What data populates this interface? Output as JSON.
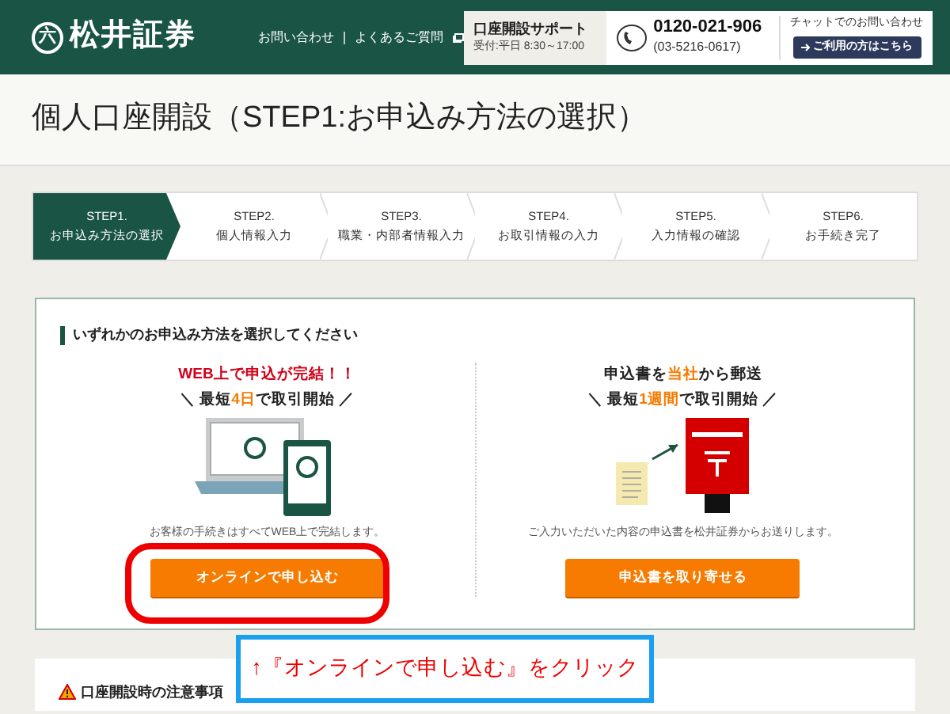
{
  "header": {
    "logo_mark": "六",
    "logo_text": "松井証券",
    "links": [
      "お問い合わせ",
      "よくあるご質問"
    ],
    "support": {
      "title": "口座開設サポート",
      "hours": "受付:平日 8:30～17:00",
      "phone": "0120-021-906",
      "phone_alt": "(03-5216-0617)",
      "chat_label": "チャットでのお問い合わせ",
      "chat_button": "ご利用の方はこちら"
    }
  },
  "page_title": "個人口座開設（STEP1:お申込み方法の選択）",
  "steps": [
    {
      "step": "STEP1.",
      "label": "お申込み方法の選択",
      "selected": true
    },
    {
      "step": "STEP2.",
      "label": "個人情報入力",
      "selected": false
    },
    {
      "step": "STEP3.",
      "label": "職業・内部者情報入力",
      "selected": false
    },
    {
      "step": "STEP4.",
      "label": "お取引情報の入力",
      "selected": false
    },
    {
      "step": "STEP5.",
      "label": "入力情報の確認",
      "selected": false
    },
    {
      "step": "STEP6.",
      "label": "お手続き完了",
      "selected": false
    }
  ],
  "section_heading": "いずれかのお申込み方法を選択してください",
  "methods": [
    {
      "kind": "online",
      "headline": [
        {
          "text": "WEB上で申込が完結！！",
          "color": "#d0021b"
        }
      ],
      "subline": [
        {
          "text": "＼ 最短",
          "color": "#222222"
        },
        {
          "text": "4日",
          "color": "#f77b00"
        },
        {
          "text": "で取引開始 ／",
          "color": "#222222"
        }
      ],
      "note": "お客様の手続きはすべてWEB上で完結します。",
      "button": "オンラインで申し込む"
    },
    {
      "kind": "mail",
      "headline": [
        {
          "text": "申込書を",
          "color": "#222222"
        },
        {
          "text": "当社",
          "color": "#f77b00"
        },
        {
          "text": "から郵送",
          "color": "#222222"
        }
      ],
      "subline": [
        {
          "text": "＼ 最短",
          "color": "#222222"
        },
        {
          "text": "1週間",
          "color": "#f77b00"
        },
        {
          "text": "で取引開始 ／",
          "color": "#222222"
        }
      ],
      "note": "ご入力いただいた内容の申込書を松井証券からお送りします。",
      "button": "申込書を取り寄せる"
    }
  ],
  "notice_heading": "口座開設時の注意事項",
  "callout": "↑『オンラインで申し込む』をクリック"
}
